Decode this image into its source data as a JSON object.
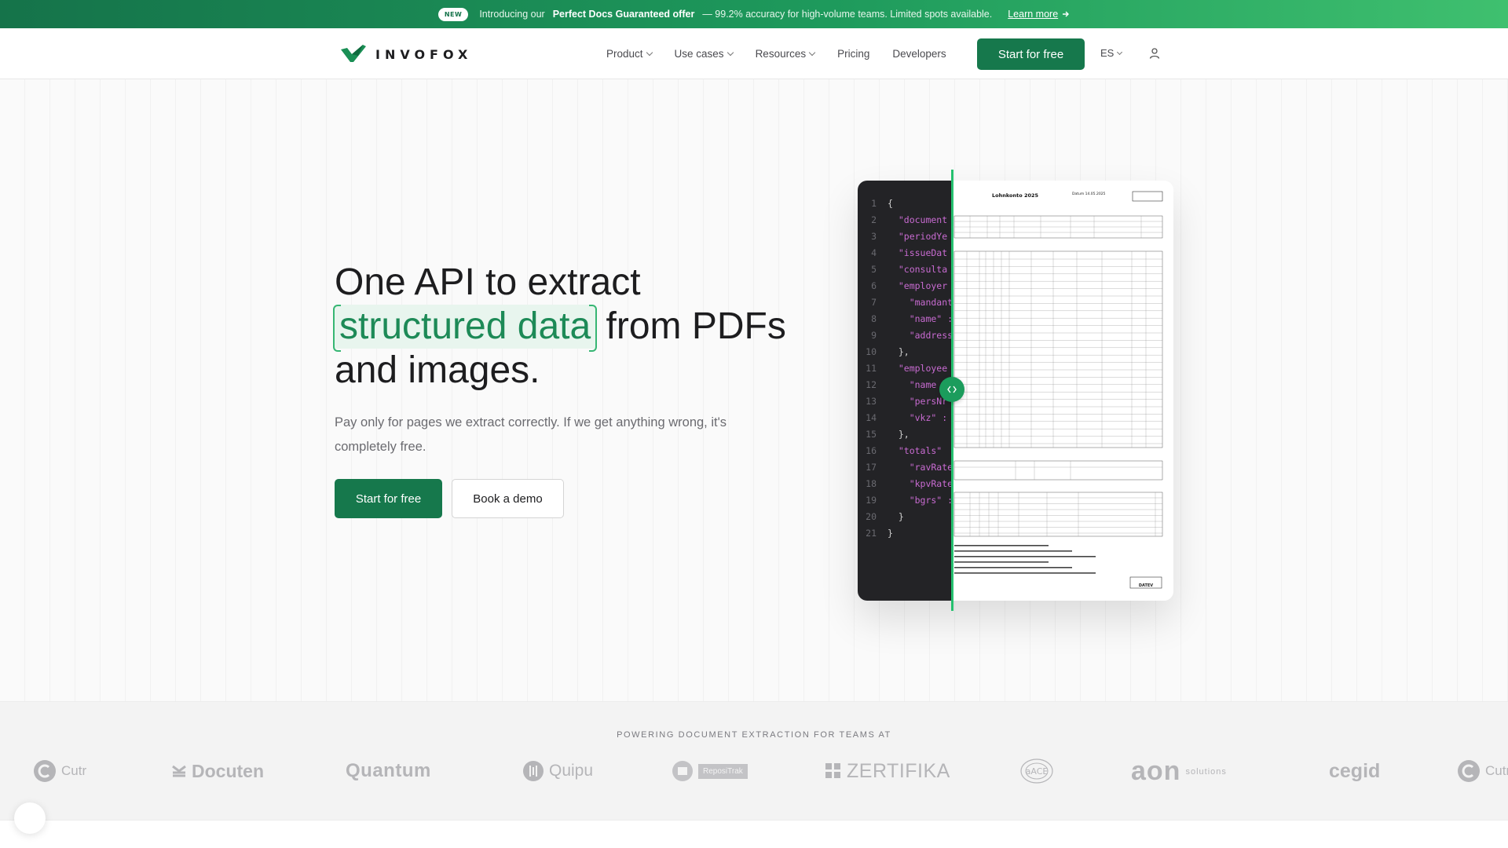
{
  "announcement": {
    "badge": "NEW",
    "prefix": "Introducing our",
    "highlight": "Perfect Docs Guaranteed offer",
    "suffix": "— 99.2% accuracy for high-volume teams. Limited spots available.",
    "link": "Learn more",
    "link_icon": "arrow-right-icon"
  },
  "nav": {
    "brand": "INVOFOX",
    "items": [
      {
        "label": "Product",
        "dropdown": true
      },
      {
        "label": "Use cases",
        "dropdown": true
      },
      {
        "label": "Resources",
        "dropdown": true
      },
      {
        "label": "Pricing",
        "dropdown": false
      },
      {
        "label": "Developers",
        "dropdown": false
      }
    ],
    "cta": "Start for free",
    "language": "ES",
    "user_icon": "user-icon"
  },
  "hero": {
    "headline_1": "One API to extract",
    "headline_accent": "structured data",
    "headline_2": "from PDFs",
    "headline_3": "and images.",
    "subtext": "Pay only for pages we extract correctly. If we get anything wrong, it's completely free.",
    "primary_cta": "Start for free",
    "secondary_cta": "Book a demo"
  },
  "code_sample": {
    "lines": [
      "{",
      "  \"document",
      "  \"periodYe",
      "  \"issueDat",
      "  \"consulta",
      "  \"employer",
      "    \"mandant",
      "    \"name\" :",
      "    \"address",
      "  },",
      "  \"employee",
      "    \"name",
      "    \"persNr",
      "    \"vkz\" :",
      "  },",
      "  \"totals\"",
      "    \"ravRate",
      "    \"kpvRate",
      "    \"bgrs\" :",
      "  }",
      "}"
    ]
  },
  "document_preview": {
    "title": "Lohnkonto 2025",
    "date_label": "Datum 14.05.2025",
    "footer": "DATEV"
  },
  "logos": {
    "title": "POWERING DOCUMENT EXTRACTION FOR TEAMS AT",
    "items": [
      "Cutr",
      "Docuten",
      "Quantum",
      "Quipu",
      "ReposiTrak",
      "ZERTIFIKA",
      "aACE",
      "aon",
      "cegid",
      "Cutr"
    ],
    "aon_suffix": "solutions"
  },
  "colors": {
    "brand_green": "#16784c",
    "accent_green": "#25c06f",
    "code_bg": "#232326",
    "code_key": "#c86bd1"
  }
}
